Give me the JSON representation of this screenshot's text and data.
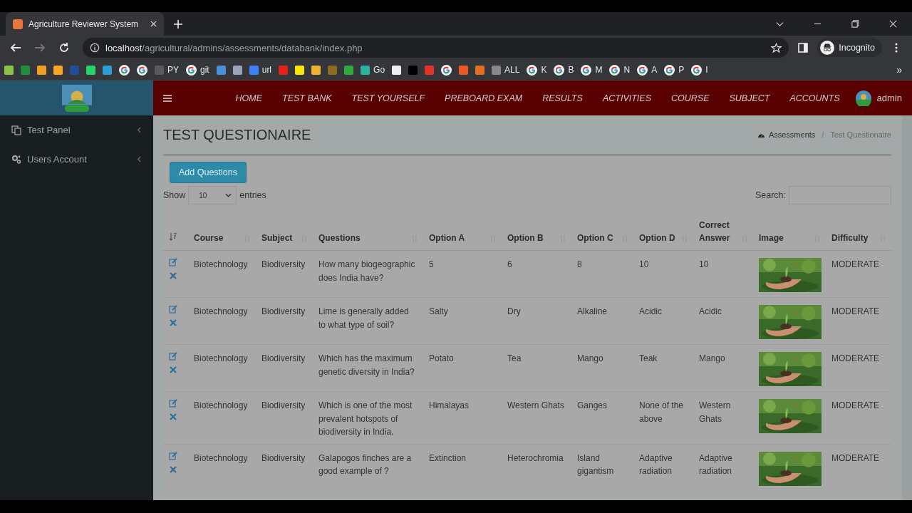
{
  "browser": {
    "tab_title": "Agriculture Reviewer System",
    "url_host": "localhost",
    "url_path": "/agricultural/admins/assessments/databank/index.php",
    "profile": "Incognito",
    "bookmarks": [
      {
        "kind": "site",
        "color": "#8bc34a"
      },
      {
        "kind": "site",
        "color": "#1e8e3e"
      },
      {
        "kind": "site",
        "color": "#f0a020"
      },
      {
        "kind": "site",
        "color": "#f5a623"
      },
      {
        "kind": "site",
        "color": "#1f4e9a"
      },
      {
        "kind": "site",
        "color": "#25d366"
      },
      {
        "kind": "site",
        "color": "#2a9fd6"
      },
      {
        "kind": "google"
      },
      {
        "kind": "google"
      },
      {
        "kind": "site",
        "color": "#5a5a5a",
        "label": "PY"
      },
      {
        "kind": "google",
        "label": "git"
      },
      {
        "kind": "site",
        "color": "#4a90d9"
      },
      {
        "kind": "site",
        "color": "#9aa4b8"
      },
      {
        "kind": "site",
        "color": "#3b82f6",
        "label": "url"
      },
      {
        "kind": "site",
        "color": "#e62117"
      },
      {
        "kind": "site",
        "color": "#f7e600"
      },
      {
        "kind": "site",
        "color": "#f0b030"
      },
      {
        "kind": "site",
        "color": "#8a6d1e"
      },
      {
        "kind": "site",
        "color": "#2eaa3e"
      },
      {
        "kind": "site",
        "color": "#2bb3a0",
        "label": "Go"
      },
      {
        "kind": "site",
        "color": "#eeeeee"
      },
      {
        "kind": "site",
        "color": "#000000"
      },
      {
        "kind": "site",
        "color": "#e0342a"
      },
      {
        "kind": "google"
      },
      {
        "kind": "site",
        "color": "#e85a20"
      },
      {
        "kind": "site",
        "color": "#e07020"
      },
      {
        "kind": "site",
        "color": "#888888",
        "label": "ALL"
      },
      {
        "kind": "google",
        "label": "K"
      },
      {
        "kind": "google",
        "label": "B"
      },
      {
        "kind": "google",
        "label": "M"
      },
      {
        "kind": "google",
        "label": "N"
      },
      {
        "kind": "google",
        "label": "A"
      },
      {
        "kind": "google",
        "label": "P"
      },
      {
        "kind": "google",
        "label": "I"
      }
    ],
    "more": "»"
  },
  "sidebar": {
    "items": [
      {
        "label": "Test Panel",
        "kind": "panel"
      },
      {
        "label": "Users Account",
        "kind": "account"
      }
    ]
  },
  "nav": {
    "items": [
      "HOME",
      "TEST BANK",
      "TEST YOURSELF",
      "PREBOARD EXAM",
      "RESULTS",
      "ACTIVITIES",
      "COURSE",
      "SUBJECT",
      "ACCOUNTS"
    ],
    "user": "admin"
  },
  "page": {
    "title": "TEST QUESTIONAIRE",
    "breadcrumb": [
      "Assessments",
      "Test Questionaire"
    ],
    "separator": "/"
  },
  "add_button": "Add Questions",
  "length": {
    "show": "Show",
    "value": "10",
    "entries": "entries"
  },
  "search": {
    "label": "Search:"
  },
  "table": {
    "columns": [
      "Course",
      "Subject",
      "Questions",
      "Option A",
      "Option B",
      "Option C",
      "Option D",
      "Correct Answer",
      "Image",
      "Difficulty"
    ],
    "rows": [
      {
        "course": "Biotechnology",
        "subject": "Biodiversity",
        "question": "How many biogeographic does India have?",
        "a": "5",
        "b": "6",
        "c": "8",
        "d": "10",
        "answer": "10",
        "difficulty": "MODERATE"
      },
      {
        "course": "Biotechnology",
        "subject": "Biodiversity",
        "question": "Lime is generally added to what type of soil?",
        "a": "Salty",
        "b": "Dry",
        "c": "Alkaline",
        "d": "Acidic",
        "answer": "Acidic",
        "difficulty": "MODERATE"
      },
      {
        "course": "Biotechnology",
        "subject": "Biodiversity",
        "question": "Which has the maximum genetic diversity in India?",
        "a": "Potato",
        "b": "Tea",
        "c": "Mango",
        "d": "Teak",
        "answer": "Mango",
        "difficulty": "MODERATE"
      },
      {
        "course": "Biotechnology",
        "subject": "Biodiversity",
        "question": "Which is one of the most prevalent hotspots of biodiversity in India.",
        "a": "Himalayas",
        "b": "Western Ghats",
        "c": "Ganges",
        "d": "None of the above",
        "answer": "Western Ghats",
        "difficulty": "MODERATE"
      },
      {
        "course": "Biotechnology",
        "subject": "Biodiversity",
        "question": "Galapogos finches are a good example of ?",
        "a": "Extinction",
        "b": "Heterochromia",
        "c": "Island gigantism",
        "d": "Adaptive radiation",
        "answer": "Adaptive radiation",
        "difficulty": "MODERATE"
      }
    ]
  }
}
